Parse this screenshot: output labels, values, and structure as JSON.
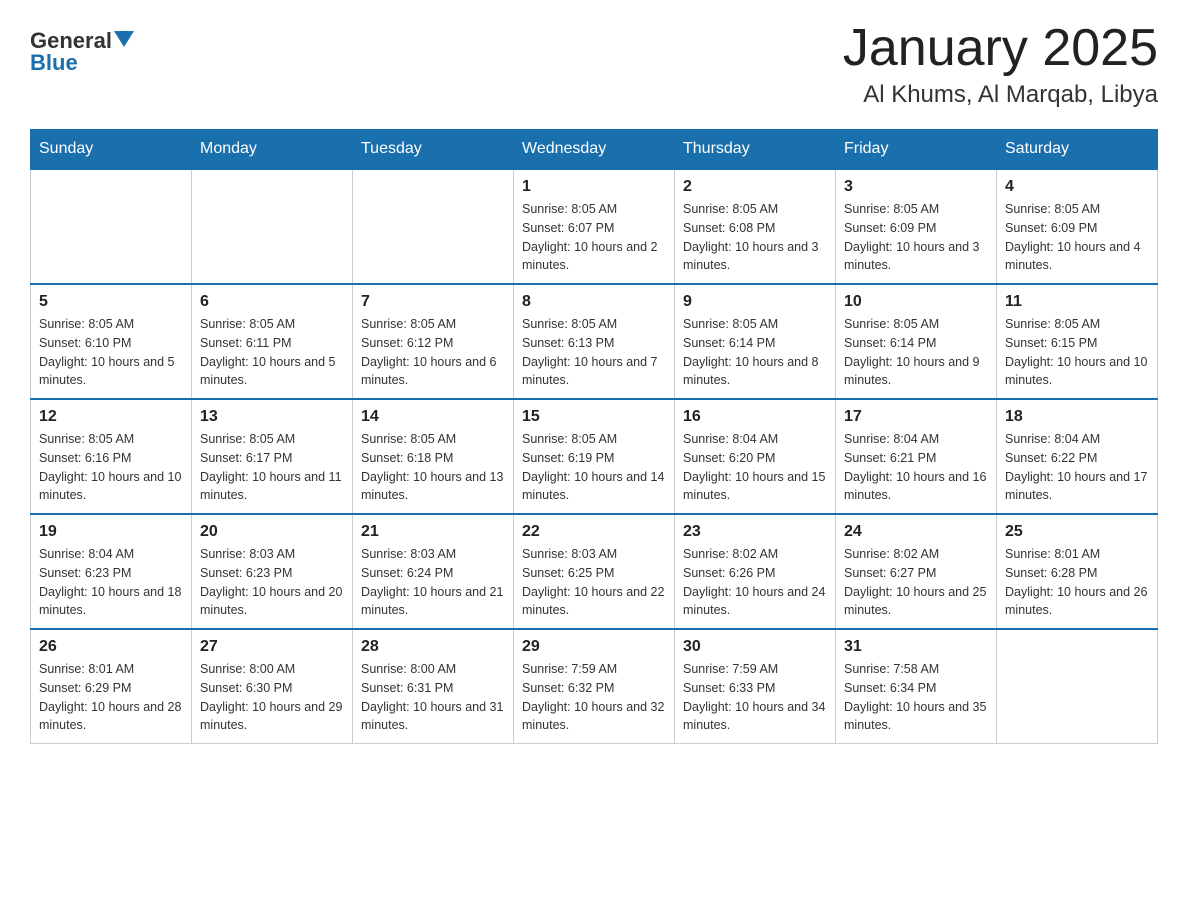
{
  "logo": {
    "text_general": "General",
    "text_blue": "Blue"
  },
  "title": "January 2025",
  "location": "Al Khums, Al Marqab, Libya",
  "days_of_week": [
    "Sunday",
    "Monday",
    "Tuesday",
    "Wednesday",
    "Thursday",
    "Friday",
    "Saturday"
  ],
  "weeks": [
    [
      {
        "day": "",
        "sunrise": "",
        "sunset": "",
        "daylight": ""
      },
      {
        "day": "",
        "sunrise": "",
        "sunset": "",
        "daylight": ""
      },
      {
        "day": "",
        "sunrise": "",
        "sunset": "",
        "daylight": ""
      },
      {
        "day": "1",
        "sunrise": "Sunrise: 8:05 AM",
        "sunset": "Sunset: 6:07 PM",
        "daylight": "Daylight: 10 hours and 2 minutes."
      },
      {
        "day": "2",
        "sunrise": "Sunrise: 8:05 AM",
        "sunset": "Sunset: 6:08 PM",
        "daylight": "Daylight: 10 hours and 3 minutes."
      },
      {
        "day": "3",
        "sunrise": "Sunrise: 8:05 AM",
        "sunset": "Sunset: 6:09 PM",
        "daylight": "Daylight: 10 hours and 3 minutes."
      },
      {
        "day": "4",
        "sunrise": "Sunrise: 8:05 AM",
        "sunset": "Sunset: 6:09 PM",
        "daylight": "Daylight: 10 hours and 4 minutes."
      }
    ],
    [
      {
        "day": "5",
        "sunrise": "Sunrise: 8:05 AM",
        "sunset": "Sunset: 6:10 PM",
        "daylight": "Daylight: 10 hours and 5 minutes."
      },
      {
        "day": "6",
        "sunrise": "Sunrise: 8:05 AM",
        "sunset": "Sunset: 6:11 PM",
        "daylight": "Daylight: 10 hours and 5 minutes."
      },
      {
        "day": "7",
        "sunrise": "Sunrise: 8:05 AM",
        "sunset": "Sunset: 6:12 PM",
        "daylight": "Daylight: 10 hours and 6 minutes."
      },
      {
        "day": "8",
        "sunrise": "Sunrise: 8:05 AM",
        "sunset": "Sunset: 6:13 PM",
        "daylight": "Daylight: 10 hours and 7 minutes."
      },
      {
        "day": "9",
        "sunrise": "Sunrise: 8:05 AM",
        "sunset": "Sunset: 6:14 PM",
        "daylight": "Daylight: 10 hours and 8 minutes."
      },
      {
        "day": "10",
        "sunrise": "Sunrise: 8:05 AM",
        "sunset": "Sunset: 6:14 PM",
        "daylight": "Daylight: 10 hours and 9 minutes."
      },
      {
        "day": "11",
        "sunrise": "Sunrise: 8:05 AM",
        "sunset": "Sunset: 6:15 PM",
        "daylight": "Daylight: 10 hours and 10 minutes."
      }
    ],
    [
      {
        "day": "12",
        "sunrise": "Sunrise: 8:05 AM",
        "sunset": "Sunset: 6:16 PM",
        "daylight": "Daylight: 10 hours and 10 minutes."
      },
      {
        "day": "13",
        "sunrise": "Sunrise: 8:05 AM",
        "sunset": "Sunset: 6:17 PM",
        "daylight": "Daylight: 10 hours and 11 minutes."
      },
      {
        "day": "14",
        "sunrise": "Sunrise: 8:05 AM",
        "sunset": "Sunset: 6:18 PM",
        "daylight": "Daylight: 10 hours and 13 minutes."
      },
      {
        "day": "15",
        "sunrise": "Sunrise: 8:05 AM",
        "sunset": "Sunset: 6:19 PM",
        "daylight": "Daylight: 10 hours and 14 minutes."
      },
      {
        "day": "16",
        "sunrise": "Sunrise: 8:04 AM",
        "sunset": "Sunset: 6:20 PM",
        "daylight": "Daylight: 10 hours and 15 minutes."
      },
      {
        "day": "17",
        "sunrise": "Sunrise: 8:04 AM",
        "sunset": "Sunset: 6:21 PM",
        "daylight": "Daylight: 10 hours and 16 minutes."
      },
      {
        "day": "18",
        "sunrise": "Sunrise: 8:04 AM",
        "sunset": "Sunset: 6:22 PM",
        "daylight": "Daylight: 10 hours and 17 minutes."
      }
    ],
    [
      {
        "day": "19",
        "sunrise": "Sunrise: 8:04 AM",
        "sunset": "Sunset: 6:23 PM",
        "daylight": "Daylight: 10 hours and 18 minutes."
      },
      {
        "day": "20",
        "sunrise": "Sunrise: 8:03 AM",
        "sunset": "Sunset: 6:23 PM",
        "daylight": "Daylight: 10 hours and 20 minutes."
      },
      {
        "day": "21",
        "sunrise": "Sunrise: 8:03 AM",
        "sunset": "Sunset: 6:24 PM",
        "daylight": "Daylight: 10 hours and 21 minutes."
      },
      {
        "day": "22",
        "sunrise": "Sunrise: 8:03 AM",
        "sunset": "Sunset: 6:25 PM",
        "daylight": "Daylight: 10 hours and 22 minutes."
      },
      {
        "day": "23",
        "sunrise": "Sunrise: 8:02 AM",
        "sunset": "Sunset: 6:26 PM",
        "daylight": "Daylight: 10 hours and 24 minutes."
      },
      {
        "day": "24",
        "sunrise": "Sunrise: 8:02 AM",
        "sunset": "Sunset: 6:27 PM",
        "daylight": "Daylight: 10 hours and 25 minutes."
      },
      {
        "day": "25",
        "sunrise": "Sunrise: 8:01 AM",
        "sunset": "Sunset: 6:28 PM",
        "daylight": "Daylight: 10 hours and 26 minutes."
      }
    ],
    [
      {
        "day": "26",
        "sunrise": "Sunrise: 8:01 AM",
        "sunset": "Sunset: 6:29 PM",
        "daylight": "Daylight: 10 hours and 28 minutes."
      },
      {
        "day": "27",
        "sunrise": "Sunrise: 8:00 AM",
        "sunset": "Sunset: 6:30 PM",
        "daylight": "Daylight: 10 hours and 29 minutes."
      },
      {
        "day": "28",
        "sunrise": "Sunrise: 8:00 AM",
        "sunset": "Sunset: 6:31 PM",
        "daylight": "Daylight: 10 hours and 31 minutes."
      },
      {
        "day": "29",
        "sunrise": "Sunrise: 7:59 AM",
        "sunset": "Sunset: 6:32 PM",
        "daylight": "Daylight: 10 hours and 32 minutes."
      },
      {
        "day": "30",
        "sunrise": "Sunrise: 7:59 AM",
        "sunset": "Sunset: 6:33 PM",
        "daylight": "Daylight: 10 hours and 34 minutes."
      },
      {
        "day": "31",
        "sunrise": "Sunrise: 7:58 AM",
        "sunset": "Sunset: 6:34 PM",
        "daylight": "Daylight: 10 hours and 35 minutes."
      },
      {
        "day": "",
        "sunrise": "",
        "sunset": "",
        "daylight": ""
      }
    ]
  ]
}
